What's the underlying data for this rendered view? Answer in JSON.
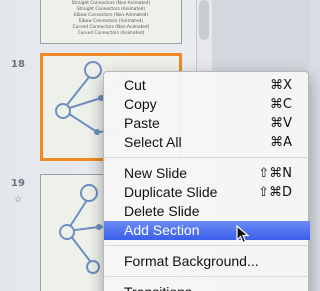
{
  "slides": [
    {
      "number": "",
      "lines": [
        "Straight Connectors (Non-Animated)",
        "Straight Connectors (Animated)",
        "Elbow Connectors (Non-Animated)",
        "Elbow Connectors (Animated)",
        "Curved Connectors (Non-Animated)",
        "Curved Connectors (Animated)"
      ]
    },
    {
      "number": "18"
    },
    {
      "number": "19",
      "animation_icon": "animation-star-icon"
    }
  ],
  "menu": {
    "items": [
      {
        "label": "Cut",
        "shortcut": "⌘X"
      },
      {
        "label": "Copy",
        "shortcut": "⌘C"
      },
      {
        "label": "Paste",
        "shortcut": "⌘V"
      },
      {
        "label": "Select All",
        "shortcut": "⌘A"
      },
      {
        "label": "New Slide",
        "shortcut": "⇧⌘N"
      },
      {
        "label": "Duplicate Slide",
        "shortcut": "⇧⌘D"
      },
      {
        "label": "Delete Slide",
        "shortcut": ""
      },
      {
        "label": "Add Section",
        "shortcut": ""
      },
      {
        "label": "Format Background...",
        "shortcut": ""
      },
      {
        "label": "Transitions",
        "shortcut": ""
      }
    ],
    "highlighted": "Add Section"
  },
  "colors": {
    "selection": "#f08a24",
    "highlight": "#3a5ee8",
    "diagram": "#6e8fc4"
  }
}
